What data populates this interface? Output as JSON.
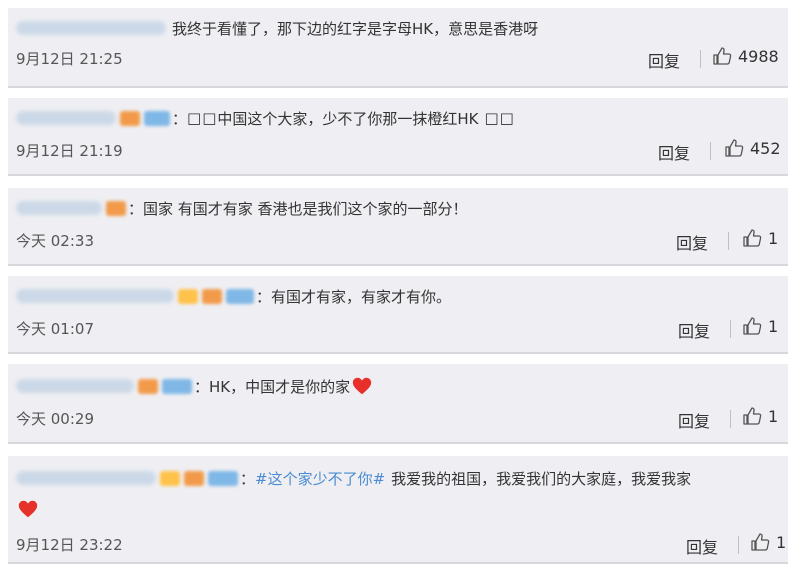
{
  "comments": [
    {
      "text": "我终于看懂了，那下边的红字是字母HK，意思是香港呀",
      "time": "9月12日 21:25",
      "reply": "回复",
      "likes": "4988",
      "badges": []
    },
    {
      "colon": "：",
      "lead": "□□",
      "text": "中国这个大家，少不了你那一抹橙红HK",
      "tail": "□□",
      "time": "9月12日 21:19",
      "reply": "回复",
      "likes": "452",
      "badges": [
        "flag",
        "blue"
      ]
    },
    {
      "colon": "：",
      "text": "国家 有国才有家 香港也是我们这个家的一部分！",
      "time": "今天 02:33",
      "reply": "回复",
      "likes": "1",
      "badges": [
        "flag"
      ]
    },
    {
      "colon": "：",
      "text": "有国才有家，有家才有你。",
      "time": "今天 01:07",
      "reply": "回复",
      "likes": "1",
      "badges": [
        "gold",
        "flag",
        "blue"
      ]
    },
    {
      "colon": "：",
      "text": "HK，中国才是你的家",
      "time": "今天 00:29",
      "reply": "回复",
      "likes": "1",
      "badges": [
        "flag",
        "blue"
      ]
    },
    {
      "colon": "：",
      "hashtag": "#这个家少不了你#",
      "text": "我爱我的祖国，我爱我们的大家庭，我爱我家",
      "time": "9月12日 23:22",
      "reply": "回复",
      "likes": "1",
      "badges": [
        "gold",
        "flag",
        "blue"
      ]
    }
  ],
  "colors": {
    "card_bg": "#efeff3",
    "hashtag": "#4a8bd1",
    "heart": "#e8302a"
  },
  "icons": {
    "like": "thumbs-up-icon",
    "heart": "red-heart-emoji-icon"
  }
}
